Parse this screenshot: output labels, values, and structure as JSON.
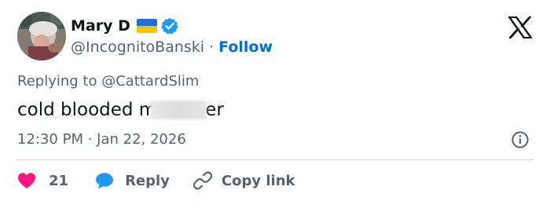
{
  "author": {
    "display_name": "Mary D",
    "handle": "@IncognitoBanski",
    "separator": "·",
    "follow_label": "Follow",
    "flag_icon": "ukraine-flag-icon",
    "verified_icon": "verified-badge-icon"
  },
  "reply_context": {
    "text": "Replying to @CattardSlim"
  },
  "tweet": {
    "text_before": "cold blooded m",
    "text_after": "er"
  },
  "meta": {
    "timestamp": "12:30 PM · Jan 22, 2026"
  },
  "actions": {
    "like_count": "21",
    "reply_label": "Reply",
    "copy_link_label": "Copy link"
  },
  "colors": {
    "accent": "#1d9bf0",
    "follow": "#006fd6",
    "like": "#f91880",
    "muted": "#536471",
    "text": "#0f1419"
  }
}
